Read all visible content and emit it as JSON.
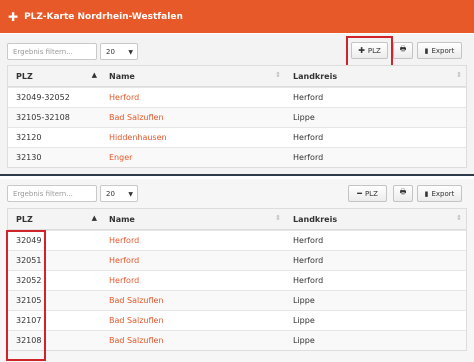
{
  "header": {
    "icon": "plus-icon",
    "title": "PLZ-Karte Nordrhein-Westfalen"
  },
  "accent_color": "#e8592a",
  "top": {
    "filter_placeholder": "Ergebnis filtern...",
    "page_size": "20",
    "plz_button_label": "PLZ",
    "plz_button_icon": "plus-icon",
    "print_icon": "print-icon",
    "export_label": "Export",
    "columns": [
      "PLZ",
      "Name",
      "Landkreis"
    ],
    "rows": [
      {
        "plz": "32049-32052",
        "name": "Herford",
        "kreis": "Herford"
      },
      {
        "plz": "32105-32108",
        "name": "Bad Salzuflen",
        "kreis": "Lippe"
      },
      {
        "plz": "32120",
        "name": "Hiddenhausen",
        "kreis": "Herford"
      },
      {
        "plz": "32130",
        "name": "Enger",
        "kreis": "Herford"
      }
    ]
  },
  "bottom": {
    "filter_placeholder": "Ergebnis filtern...",
    "page_size": "20",
    "plz_button_label": "PLZ",
    "plz_button_icon": "minus-icon",
    "print_icon": "print-icon",
    "export_label": "Export",
    "columns": [
      "PLZ",
      "Name",
      "Landkreis"
    ],
    "rows": [
      {
        "plz": "32049",
        "name": "Herford",
        "kreis": "Herford"
      },
      {
        "plz": "32051",
        "name": "Herford",
        "kreis": "Herford"
      },
      {
        "plz": "32052",
        "name": "Herford",
        "kreis": "Herford"
      },
      {
        "plz": "32105",
        "name": "Bad Salzuflen",
        "kreis": "Lippe"
      },
      {
        "plz": "32107",
        "name": "Bad Salzuflen",
        "kreis": "Lippe"
      },
      {
        "plz": "32108",
        "name": "Bad Salzuflen",
        "kreis": "Lippe"
      }
    ]
  }
}
